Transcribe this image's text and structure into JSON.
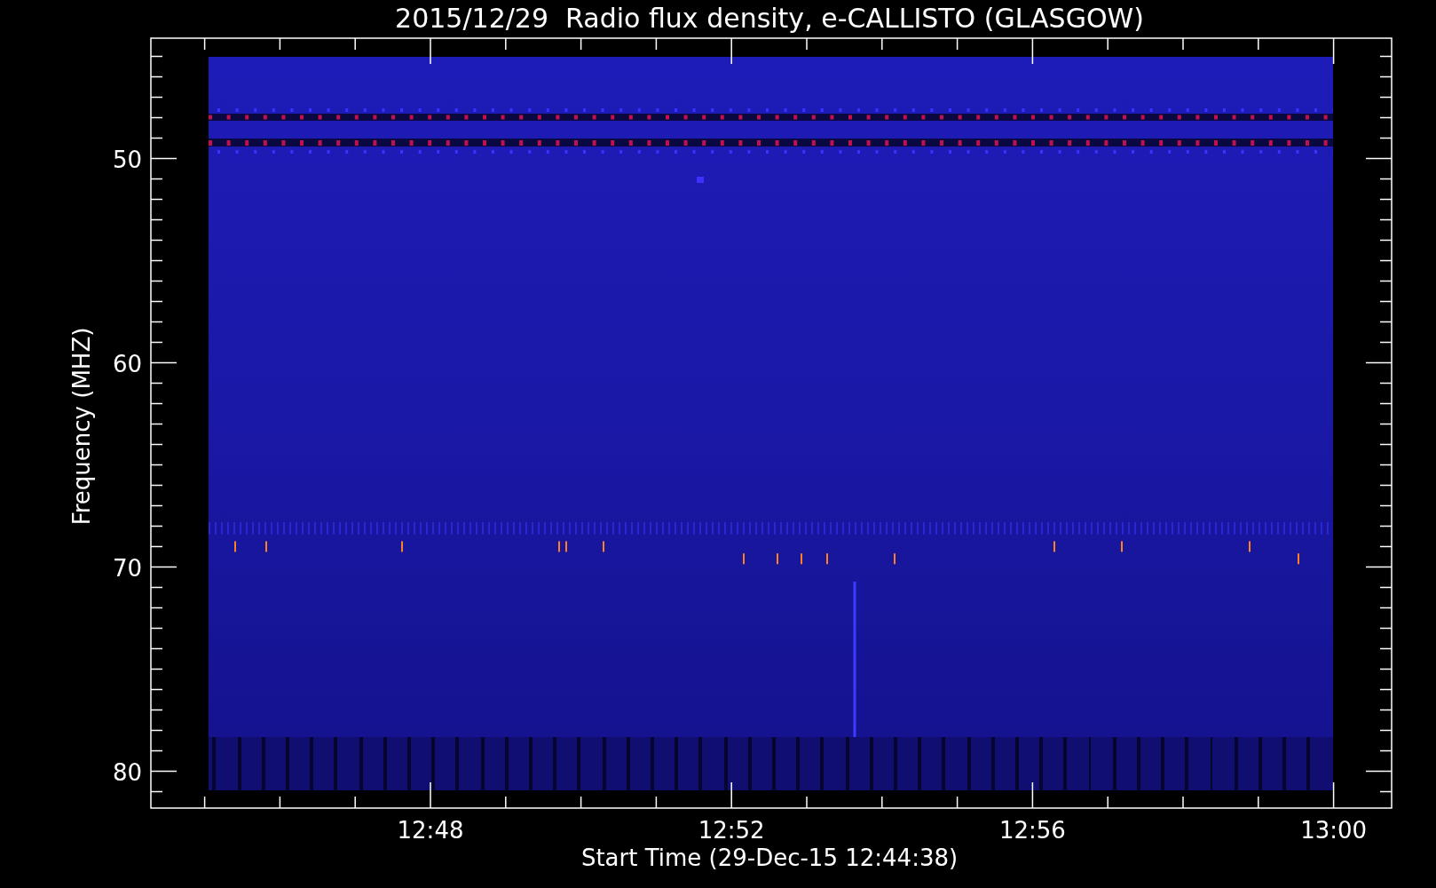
{
  "title": "2015/12/29  Radio flux density, e-CALLISTO (GLASGOW)",
  "y_axis": {
    "label": "Frequency (MHZ)",
    "ticks": [
      "50",
      "60",
      "70",
      "80"
    ]
  },
  "x_axis": {
    "label": "Start Time (29-Dec-15 12:44:38)",
    "ticks": [
      "12:48",
      "12:52",
      "12:56",
      "13:00"
    ]
  }
}
